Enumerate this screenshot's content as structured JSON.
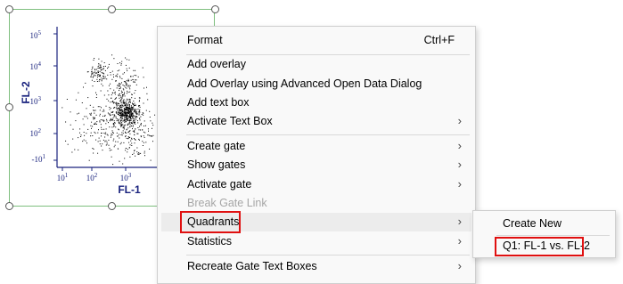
{
  "plot": {
    "y_axis_label": "FL-2",
    "x_axis_label": "FL-1",
    "y_ticks": [
      {
        "base": "10",
        "exp": "5"
      },
      {
        "base": "10",
        "exp": "4"
      },
      {
        "base": "10",
        "exp": "3"
      },
      {
        "base": "10",
        "exp": "2"
      },
      {
        "base": "-10",
        "exp": "1"
      }
    ],
    "x_ticks": [
      {
        "base": "10",
        "exp": "1"
      },
      {
        "base": "10",
        "exp": "2"
      },
      {
        "base": "10",
        "exp": "3"
      }
    ],
    "dot_color": "#000000",
    "axis_color": "#1a237e"
  },
  "context_menu": {
    "format_label": "Format",
    "format_shortcut": "Ctrl+F",
    "add_overlay_label": "Add overlay",
    "add_overlay_advanced_label": "Add Overlay using Advanced Open Data Dialog",
    "add_text_box_label": "Add text box",
    "activate_text_box_label": "Activate Text Box",
    "create_gate_label": "Create gate",
    "show_gates_label": "Show gates",
    "activate_gate_label": "Activate gate",
    "break_gate_link_label": "Break Gate Link",
    "quadrants_label": "Quadrants",
    "statistics_label": "Statistics",
    "recreate_gate_text_boxes_label": "Recreate Gate Text Boxes",
    "submenu_arrow": "›"
  },
  "quadrants_submenu": {
    "create_new_label": "Create New",
    "q1_label": "Q1: FL-1 vs. FL-2"
  },
  "highlight_color": "#e01010"
}
